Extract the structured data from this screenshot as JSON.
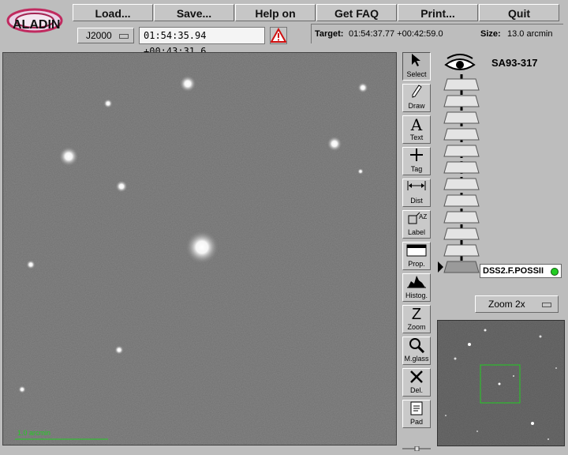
{
  "app": {
    "logo_text": "ALADIN"
  },
  "menu": {
    "load": "Load...",
    "save": "Save...",
    "help": "Help on",
    "faq": "Get FAQ",
    "print": "Print...",
    "quit": "Quit"
  },
  "frame": {
    "selected": "J2000"
  },
  "location": {
    "value": "01:54:35.94 +00:43:31.6"
  },
  "target": {
    "label": "Target:",
    "value": "01:54:37.77 +00:42:59.0",
    "size_label": "Size:",
    "size_value": "13.0 arcmin"
  },
  "image": {
    "scale_label": "1.0 arcmin"
  },
  "tools": [
    {
      "label": "Select",
      "icon": "arrow-cursor-icon"
    },
    {
      "label": "Draw",
      "icon": "pencil-icon"
    },
    {
      "label": "Text",
      "icon": "text-icon"
    },
    {
      "label": "Tag",
      "icon": "crosshair-icon"
    },
    {
      "label": "Dist",
      "icon": "distance-icon"
    },
    {
      "label": "Label",
      "icon": "label-icon"
    },
    {
      "label": "Prop.",
      "icon": "properties-icon"
    },
    {
      "label": "Histog.",
      "icon": "histogram-icon"
    },
    {
      "label": "Zoom",
      "icon": "zoom-icon"
    },
    {
      "label": "M.glass",
      "icon": "magnifier-icon"
    },
    {
      "label": "Del.",
      "icon": "delete-icon"
    },
    {
      "label": "Pad",
      "icon": "notepad-icon"
    }
  ],
  "stack": {
    "object_name": "SA93-317",
    "survey": "DSS2.F.POSSII",
    "status_color": "#22cc22",
    "plane_count": 12
  },
  "zoom": {
    "selected": "Zoom 2x"
  },
  "colors": {
    "overlay_green": "#22cc22",
    "background": "#bdbdbd"
  }
}
